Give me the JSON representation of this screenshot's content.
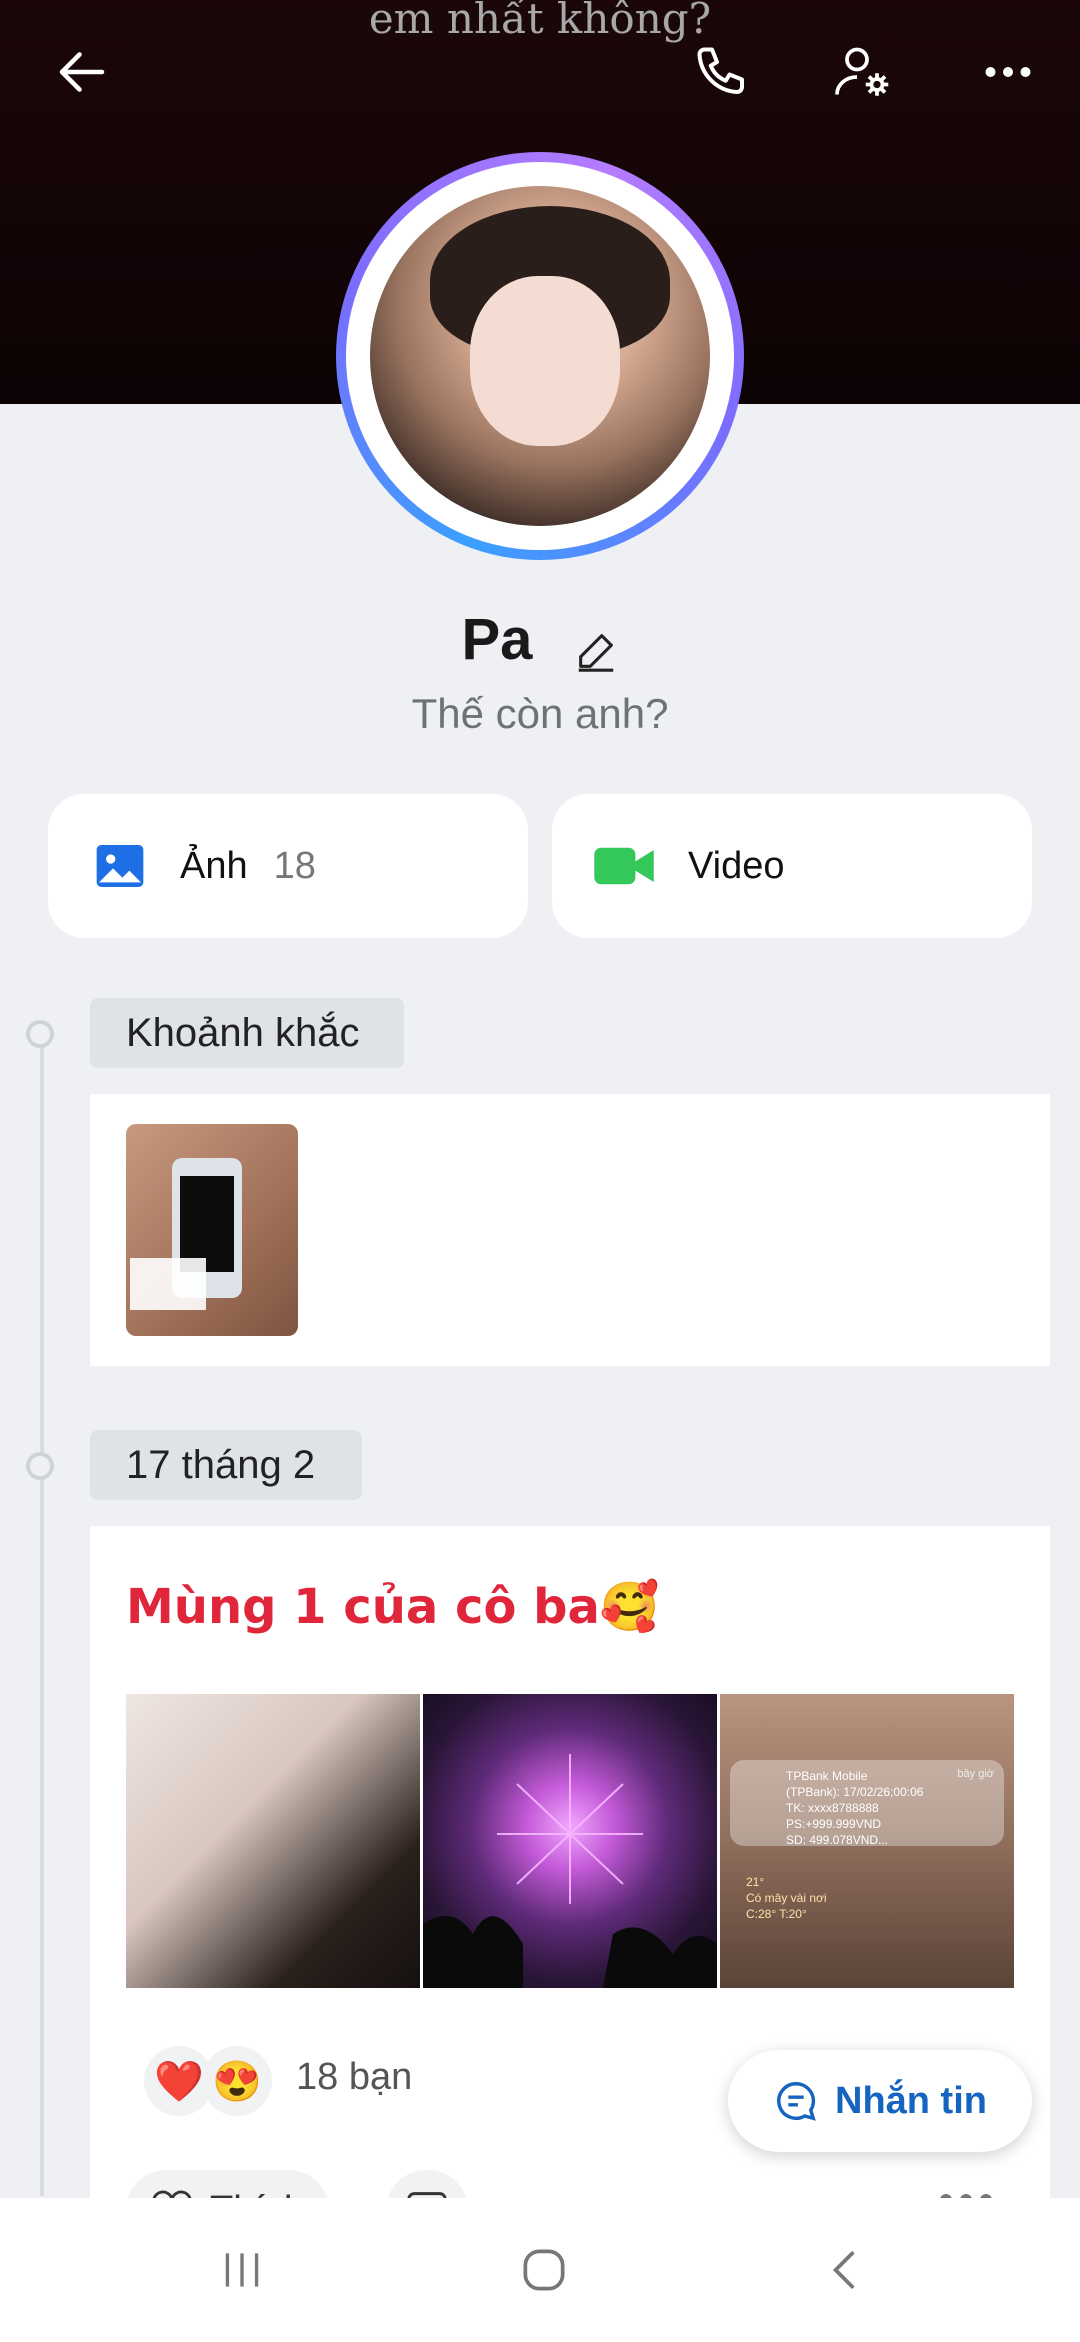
{
  "cover": {
    "overlay_text": "em nhất không?"
  },
  "top_bar": {
    "back_icon": "arrow-left-icon",
    "call_icon": "phone-icon",
    "settings_icon": "user-gear-icon",
    "more_icon": "more-horizontal-icon"
  },
  "profile": {
    "name": "Pa",
    "edit_icon": "pencil-icon",
    "status": "Thế còn anh?"
  },
  "media_cards": [
    {
      "label": "Ảnh",
      "count": "18",
      "icon": "image-icon",
      "color": "#1e6fe6"
    },
    {
      "label": "Video",
      "icon": "video-icon",
      "color": "#34c759"
    }
  ],
  "timeline": {
    "moments_label": "Khoảnh khắc",
    "date_label": "17 tháng 2"
  },
  "post": {
    "title": "Mùng 1 của cô ba🥰",
    "notif": {
      "app": "TPBank Mobile",
      "time": "bây giờ",
      "line1": "(TPBank): 17/02/26;00:06",
      "line2": "TK: xxxx8788888",
      "line3": "PS:+999.999VND",
      "line4": "SD: 499.078VND..."
    },
    "weather": {
      "temp": "21°",
      "desc": "Có mây vài nơi",
      "range": "C:28° T:20°"
    },
    "reactions": [
      "❤️",
      "😍"
    ],
    "reaction_count": "18 bạn",
    "like_label": "Thích"
  },
  "message_button": {
    "label": "Nhắn tin"
  },
  "colors": {
    "accent": "#1565c0",
    "title_red": "#e0263a"
  }
}
